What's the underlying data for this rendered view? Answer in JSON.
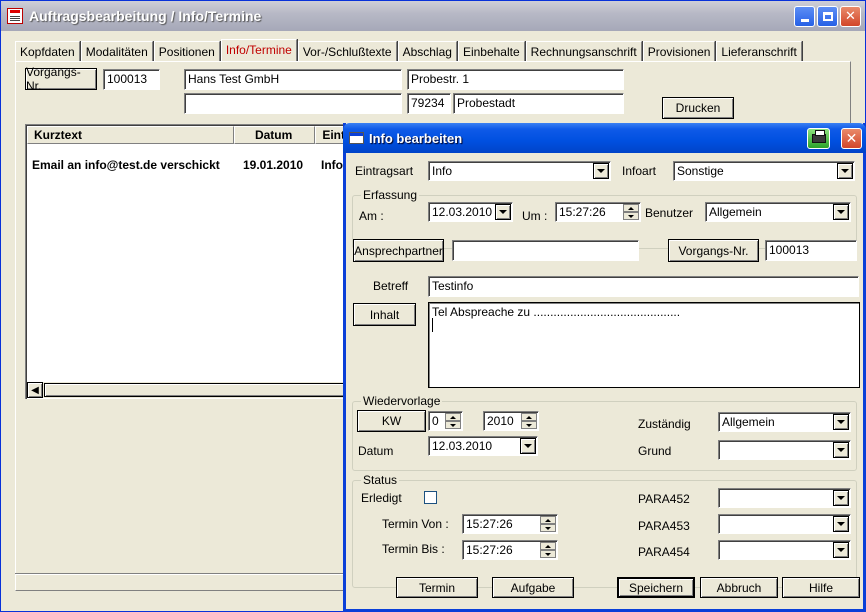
{
  "window": {
    "title": "Auftragsbearbeitung / Info/Termine"
  },
  "tabs": [
    {
      "label": "Kopfdaten"
    },
    {
      "label": "Modalitäten"
    },
    {
      "label": "Positionen"
    },
    {
      "label": "Info/Termine"
    },
    {
      "label": "Vor-/Schlußtexte"
    },
    {
      "label": "Abschlag"
    },
    {
      "label": "Einbehalte"
    },
    {
      "label": "Rechnungsanschrift"
    },
    {
      "label": "Provisionen"
    },
    {
      "label": "Lieferanschrift"
    }
  ],
  "header": {
    "vorgangs_label": "Vorgangs-Nr.",
    "vorgangs_value": "100013",
    "company": "Hans Test GmbH",
    "street": "Probestr. 1",
    "extra": "",
    "zip": "79234",
    "city": "Probestadt",
    "print_label": "Drucken"
  },
  "list": {
    "columns": [
      "Kurztext",
      "Datum",
      "Eintr"
    ],
    "rows": [
      {
        "kurztext": "Email an info@test.de verschickt",
        "datum": "19.01.2010",
        "eintr": "Info"
      }
    ]
  },
  "dialog": {
    "title": "Info bearbeiten",
    "eintragsart_label": "Eintragsart",
    "eintragsart_value": "Info",
    "infoart_label": "Infoart",
    "infoart_value": "Sonstige",
    "erfassung": {
      "title": "Erfassung",
      "am_label": "Am :",
      "am_value": "12.03.2010",
      "um_label": "Um :",
      "um_value": "15:27:26",
      "benutzer_label": "Benutzer",
      "benutzer_value": "Allgemein"
    },
    "ansprechpartner_label": "Ansprechpartner",
    "ansprechpartner_value": "",
    "vorgangs_label": "Vorgangs-Nr.",
    "vorgangs_value": "100013",
    "betreff_label": "Betreff",
    "betreff_value": "Testinfo",
    "inhalt_label": "Inhalt",
    "inhalt_value": "Tel Abspreache zu ............................................",
    "wiedervorlage": {
      "title": "Wiedervorlage",
      "kw_label": "KW",
      "kw_value": "0",
      "year_value": "2010",
      "datum_label": "Datum",
      "datum_value": "12.03.2010",
      "zustaendig_label": "Zuständig",
      "zustaendig_value": "Allgemein",
      "grund_label": "Grund",
      "grund_value": ""
    },
    "status": {
      "title": "Status",
      "erledigt_label": "Erledigt",
      "termin_von_label": "Termin Von :",
      "termin_von_value": "15:27:26",
      "termin_bis_label": "Termin Bis :",
      "termin_bis_value": "15:27:26",
      "para452_label": "PARA452",
      "para452_value": "",
      "para453_label": "PARA453",
      "para453_value": "",
      "para454_label": "PARA454",
      "para454_value": ""
    },
    "buttons": {
      "termin": "Termin",
      "aufgabe": "Aufgabe",
      "speichern": "Speichern",
      "abbruch": "Abbruch",
      "hilfe": "Hilfe"
    }
  }
}
